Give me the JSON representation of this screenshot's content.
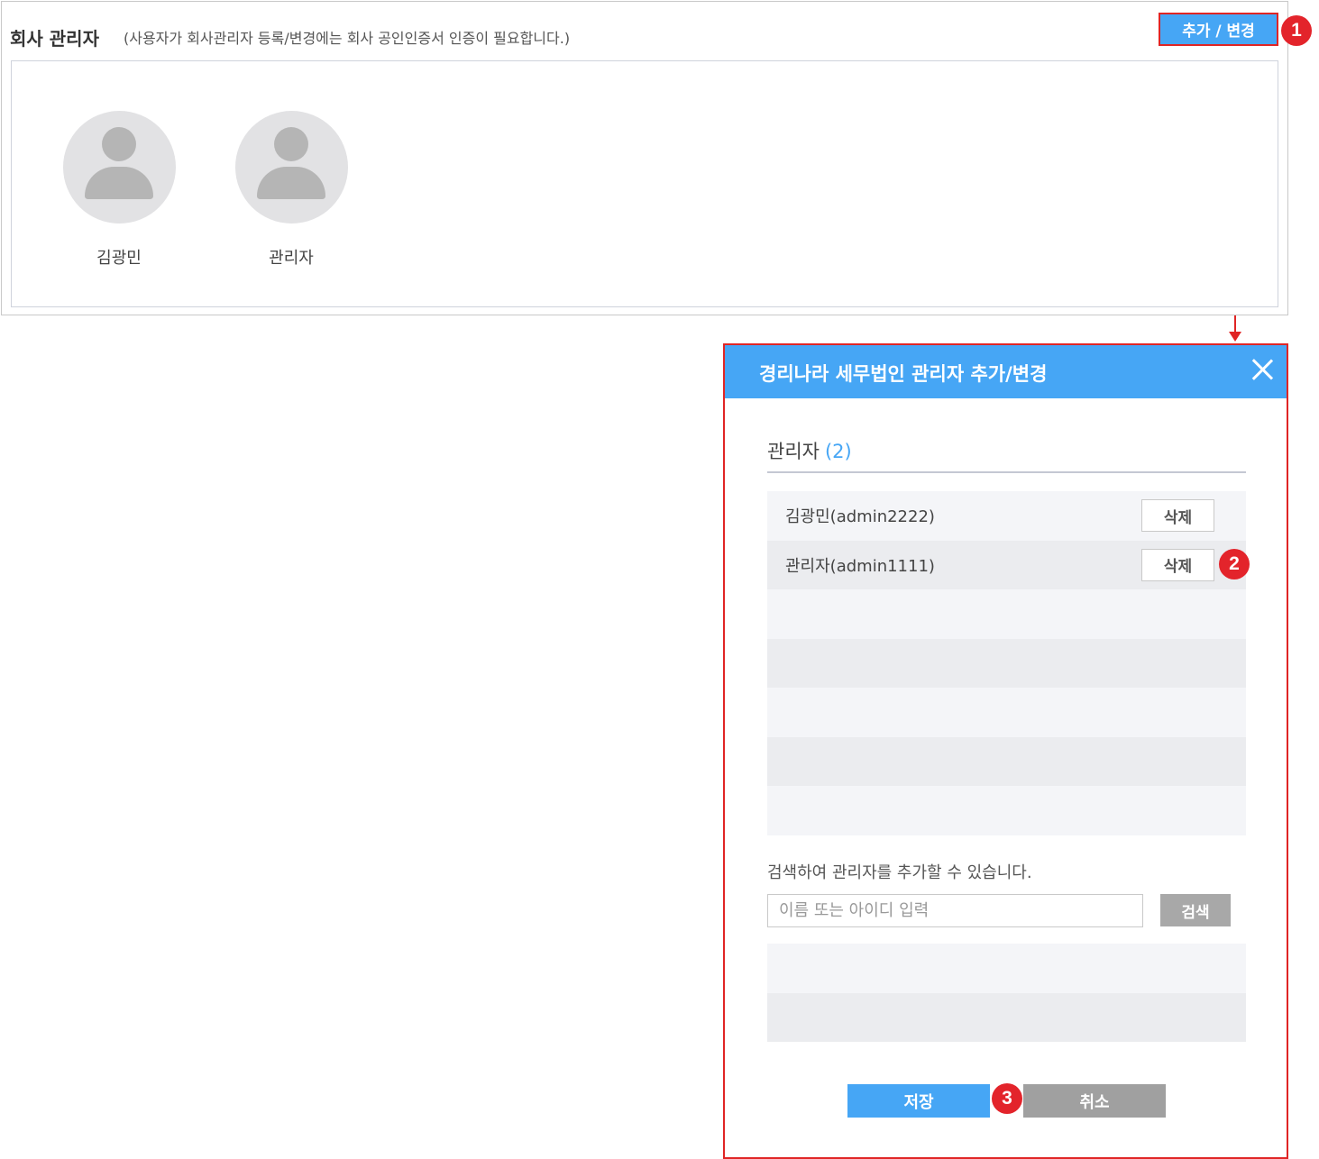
{
  "company_admin": {
    "title": "회사 관리자",
    "note": "(사용자가 회사관리자 등록/변경에는 회사 공인인증서 인증이 필요합니다.)",
    "add_change_label": "추가 / 변경",
    "members": [
      {
        "name": "김광민",
        "icon": "user-avatar-icon"
      },
      {
        "name": "관리자",
        "icon": "user-avatar-icon"
      }
    ]
  },
  "badges": {
    "step1": "1",
    "step2": "2",
    "step3": "3"
  },
  "modal": {
    "title": "경리나라 세무법인 관리자 추가/변경",
    "close_icon": "close-icon",
    "admins_label": "관리자",
    "admins_count": "(2)",
    "admins": [
      {
        "text": "김광민(admin2222)",
        "delete_label": "삭제"
      },
      {
        "text": "관리자(admin1111)",
        "delete_label": "삭제"
      }
    ],
    "search_hint": "검색하여 관리자를 추가할 수 있습니다.",
    "search_placeholder": "이름 또는 아이디 입력",
    "search_label": "검색",
    "save_label": "저장",
    "cancel_label": "취소"
  },
  "colors": {
    "accent": "#46a6f5",
    "highlight_border": "#e02525",
    "badge": "#e3242b",
    "button_gray": "#a8a8a8"
  }
}
